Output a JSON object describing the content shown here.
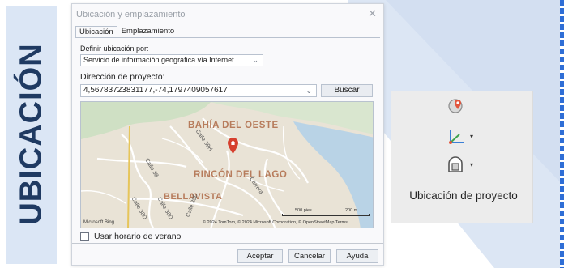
{
  "side": {
    "title": "UBICACIÓN"
  },
  "dialog": {
    "title": "Ubicación y emplazamiento",
    "close_glyph": "✕",
    "tabs": [
      {
        "label": "Ubicación",
        "active": true
      },
      {
        "label": "Emplazamiento",
        "active": false
      }
    ],
    "define_label": "Definir ubicación por:",
    "define_value": "Servicio de información geográfica vía Internet",
    "address_label": "Dirección de proyecto:",
    "address_value": "4,56783723831177,-74,1797409057617",
    "search_button": "Buscar",
    "map": {
      "places": [
        "BAHÍA DEL OESTE",
        "RINCÓN DEL LAGO",
        "BELLAVISTA"
      ],
      "streets": [
        "Calle 39H",
        "Calle 38",
        "Calle 38D",
        "Calle 38D",
        "Calle 38D",
        "Carrera"
      ],
      "logo": "Microsoft Bing",
      "attribution": "© 2024 TomTom, © 2024 Microsoft Corporation, © OpenStreetMap  Terms",
      "scale_feet": "500 pies",
      "scale_meters": "200 m"
    },
    "dst_label": "Usar horario de verano",
    "dst_checked": false,
    "buttons": {
      "ok": "Aceptar",
      "cancel": "Cancelar",
      "help": "Ayuda"
    }
  },
  "ribbon": {
    "icons": [
      "location-pin-icon",
      "coordinate-axes-icon",
      "project-location-icon"
    ],
    "label": "Ubicación de proyecto"
  },
  "colors": {
    "accent": "#1f3a62",
    "band": "#dbe6f5",
    "dash": "#2f6ed6",
    "pin": "#d6402e",
    "place_text": "#b77c5c"
  }
}
